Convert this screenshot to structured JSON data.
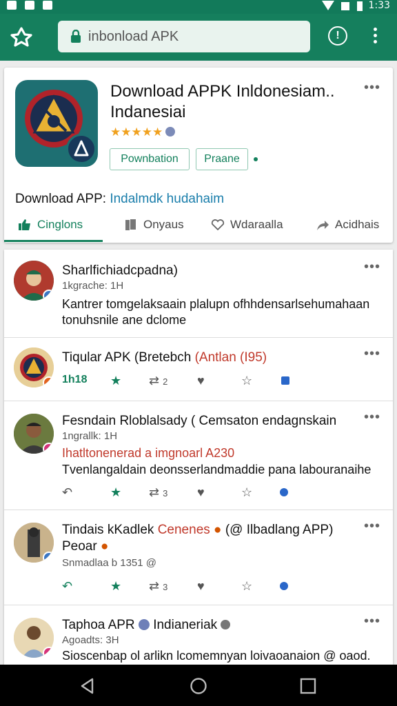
{
  "browser": {
    "url": "inbonload APK"
  },
  "app": {
    "title": "Download APPK Inldonesiam.. Indanesiai",
    "rating_stars": "★★★★★",
    "primary_button": "Pownbation",
    "secondary_button": "Praane",
    "download_label": "Download APP:",
    "download_highlight": "Indalmdk hudahaim",
    "tabs": [
      {
        "label": "Cinglons",
        "icon": "thumbs-up-icon"
      },
      {
        "label": "Onyaus",
        "icon": "bookmark-icon"
      },
      {
        "label": "Wdaraalla",
        "icon": "heart-icon"
      },
      {
        "label": "Acidhais",
        "icon": "share-icon"
      }
    ]
  },
  "posts": [
    {
      "name": "Sharlfichiadcpadna)",
      "sub": "1kgrache: 1H",
      "body": "Kantrer tomgelaksaain plalupn ofhhdensarlsehumahaan tonuhsnile ane dclome"
    },
    {
      "name": "Tiqular APK (Bretebch",
      "name_red": "(Antlan (I95)",
      "actions": [
        "1h18",
        "",
        "2",
        "",
        "",
        ""
      ]
    },
    {
      "name": "Fesndain Rloblalsady ( Cemsaton endagnskain",
      "sub": "1ngrallk: 1H",
      "body_red": "Ihatltonenerad a imgnoarl A230",
      "body": "Tvenlangaldain deonsserlandmaddie pana  labouranaihe",
      "actions": [
        "",
        "",
        "3",
        "",
        "",
        ""
      ]
    },
    {
      "name": "Tindais kKadlek",
      "name_red": "Cenenes",
      "name_rest": "(@ Ilbadlang APP)",
      "name2": "Peoar",
      "sub": "Snmadlaa b 1351 @",
      "actions": [
        "",
        "",
        "3",
        "",
        "",
        ""
      ]
    },
    {
      "name": "Taphoa APR",
      "name_rest": "Indianeriak",
      "sub": "Agoadts: 3H",
      "body": "Sioscenbap ol arlikn lcomemnyan loivaoanaion @ oaod."
    }
  ]
}
